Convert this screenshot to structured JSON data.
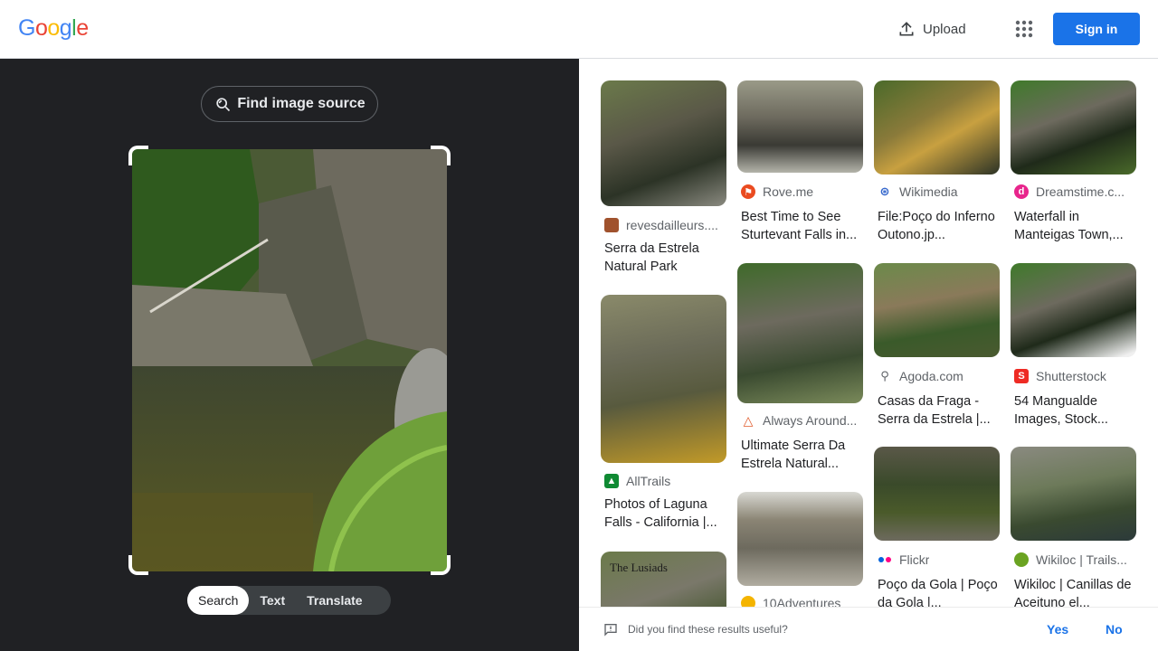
{
  "header": {
    "logo_letters": [
      {
        "ch": "G",
        "color": "#4285F4"
      },
      {
        "ch": "o",
        "color": "#EA4335"
      },
      {
        "ch": "o",
        "color": "#FBBC05"
      },
      {
        "ch": "g",
        "color": "#4285F4"
      },
      {
        "ch": "l",
        "color": "#34A853"
      },
      {
        "ch": "e",
        "color": "#EA4335"
      }
    ],
    "upload_label": "Upload",
    "apps_icon": "apps-grid-icon",
    "signin_label": "Sign in"
  },
  "left_panel": {
    "find_source_label": "Find image source",
    "modes": [
      "Search",
      "Text",
      "Translate"
    ],
    "active_mode": "Search"
  },
  "results": [
    {
      "source": "revesdailleurs....",
      "favicon_color": "#a0522d",
      "title": "Serra da Estrela Natural Park"
    },
    {
      "source": "AllTrails",
      "favicon_color": "#0f8a33",
      "title": "Photos of Laguna Falls - California |..."
    },
    {
      "source": "",
      "favicon_color": "#c8a000",
      "title": "The Lusiads"
    },
    {
      "source": "Rove.me",
      "favicon_color": "#ea4b20",
      "title": "Best Time to See Sturtevant Falls in..."
    },
    {
      "source": "Always Around...",
      "favicon_color": "#e05b2c",
      "title": "Ultimate Serra Da Estrela Natural..."
    },
    {
      "source": "10Adventures",
      "favicon_color": "#f4b400",
      "title": ""
    },
    {
      "source": "Wikimedia",
      "favicon_color": "#3366cc",
      "title": "File:Poço do Inferno Outono.jp..."
    },
    {
      "source": "Agoda.com",
      "favicon_color": "#5f6368",
      "title": "Casas da Fraga - Serra da Estrela |..."
    },
    {
      "source": "Flickr",
      "favicon_color": "#ff0084",
      "title": "Poço da Gola | Poço da Gola |..."
    },
    {
      "source": "Dreamstime.c...",
      "favicon_color": "#e8258c",
      "title": "Waterfall in Manteigas Town,..."
    },
    {
      "source": "Shutterstock",
      "favicon_color": "#ee2b24",
      "title": "54 Mangualde Images, Stock..."
    },
    {
      "source": "Wikiloc | Trails...",
      "favicon_color": "#6aa321",
      "title": "Wikiloc | Canillas de Aceituno el..."
    }
  ],
  "feedback": {
    "question": "Did you find these results useful?",
    "yes": "Yes",
    "no": "No"
  }
}
